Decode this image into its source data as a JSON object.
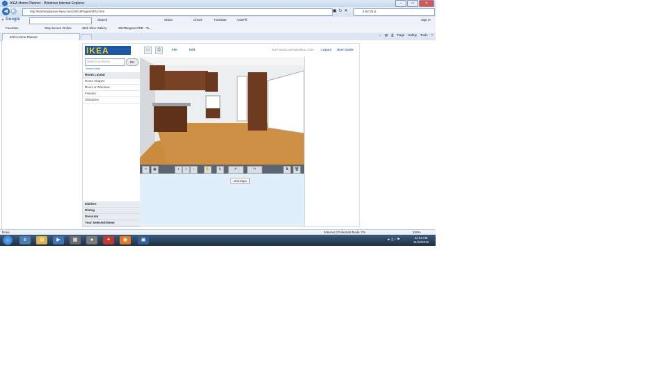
{
  "window": {
    "title": "IKEA Home Planner - Windows Internet Explorer"
  },
  "browser": {
    "address": "http://kitchenplanner.ikea.com/US/UI/Pages/VPUI.htm",
    "search_value": "2.54*31.5",
    "google_label": "Google",
    "toolbar": {
      "search": "Search",
      "share": "Share",
      "check": "Check",
      "translate": "Translate",
      "autofill": "AutoFill",
      "signin": "Sign In"
    },
    "favorites": {
      "label": "Favorites",
      "items": [
        "Stay Secure Online",
        "Web Slice Gallery",
        "WildTangent ORB - To..."
      ]
    },
    "tab": {
      "label": "IKEA Home Planner"
    },
    "command_bar": {
      "page": "Page",
      "safety": "Safety",
      "tools": "Tools"
    }
  },
  "app": {
    "logo": "IKEA",
    "menu": {
      "file": "File",
      "edit": "Edit"
    },
    "user_email": "MATTHGALL0029@GMAIL.COM",
    "logout": "Logout",
    "user_guide": "User Guide",
    "search": {
      "placeholder": "Search products",
      "ok": "OK",
      "help": "Search help"
    },
    "sidebar": {
      "section_title": "Room Layout",
      "items": [
        "Room Shapes",
        "Doors & Windows",
        "Fixtures",
        "Obstacles"
      ],
      "bottom_sections": [
        "Kitchen",
        "Dining",
        "Decorate",
        "Your Selected Items"
      ]
    },
    "tooltip": "Orbit Right",
    "icons": [
      "save-icon",
      "print-icon",
      "2d-view-icon",
      "3d-view-icon",
      "zoom-in-icon",
      "zoom-icon",
      "zoom-out-icon",
      "pan-icon",
      "rotate-icon",
      "orbit-left-icon",
      "orbit-right-icon",
      "copy-icon",
      "delete-icon"
    ]
  },
  "status": {
    "left": "Done",
    "zone": "Internet | Protected Mode: On",
    "zoom": "100%"
  },
  "taskbar": {
    "time": "11:13 AM",
    "date": "11/13/2010"
  }
}
